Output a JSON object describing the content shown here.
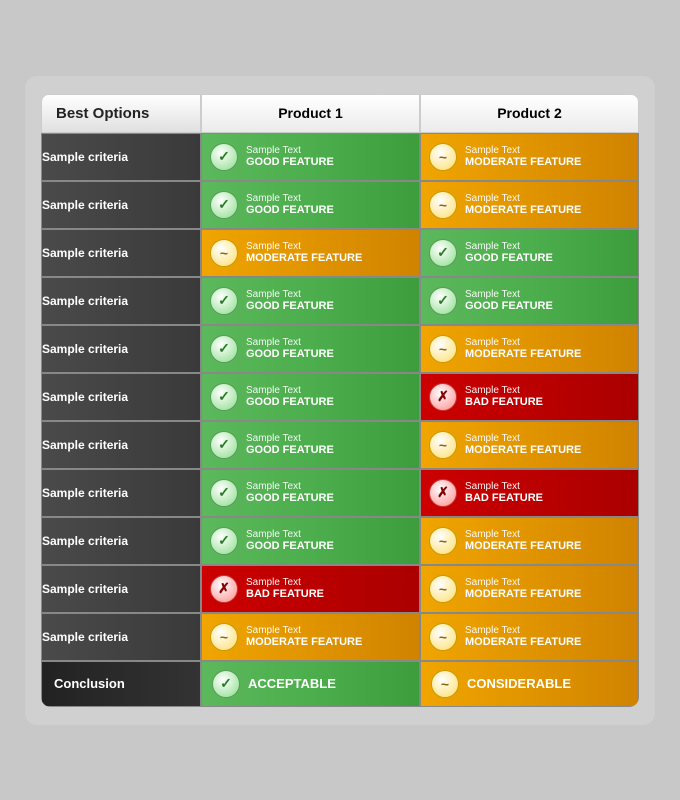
{
  "header": {
    "col1": "Best Options",
    "col2": "Product 1",
    "col3": "Product 2"
  },
  "rows": [
    {
      "criteria": "Sample criteria",
      "p1": {
        "type": "good",
        "subtitle": "Sample Text",
        "title": "GOOD FEATURE"
      },
      "p2": {
        "type": "moderate",
        "subtitle": "Sample Text",
        "title": "MODERATE FEATURE"
      }
    },
    {
      "criteria": "Sample criteria",
      "p1": {
        "type": "good",
        "subtitle": "Sample Text",
        "title": "GOOD FEATURE"
      },
      "p2": {
        "type": "moderate",
        "subtitle": "Sample Text",
        "title": "MODERATE FEATURE"
      }
    },
    {
      "criteria": "Sample criteria",
      "p1": {
        "type": "moderate",
        "subtitle": "Sample Text",
        "title": "MODERATE FEATURE"
      },
      "p2": {
        "type": "good",
        "subtitle": "Sample Text",
        "title": "GOOD FEATURE"
      }
    },
    {
      "criteria": "Sample criteria",
      "p1": {
        "type": "good",
        "subtitle": "Sample Text",
        "title": "GOOD FEATURE"
      },
      "p2": {
        "type": "good",
        "subtitle": "Sample Text",
        "title": "GOOD FEATURE"
      }
    },
    {
      "criteria": "Sample criteria",
      "p1": {
        "type": "good",
        "subtitle": "Sample Text",
        "title": "GOOD FEATURE"
      },
      "p2": {
        "type": "moderate",
        "subtitle": "Sample Text",
        "title": "MODERATE FEATURE"
      }
    },
    {
      "criteria": "Sample criteria",
      "p1": {
        "type": "good",
        "subtitle": "Sample Text",
        "title": "GOOD FEATURE"
      },
      "p2": {
        "type": "bad",
        "subtitle": "Sample Text",
        "title": "BAD FEATURE"
      }
    },
    {
      "criteria": "Sample criteria",
      "p1": {
        "type": "good",
        "subtitle": "Sample Text",
        "title": "GOOD FEATURE"
      },
      "p2": {
        "type": "moderate",
        "subtitle": "Sample Text",
        "title": "MODERATE FEATURE"
      }
    },
    {
      "criteria": "Sample criteria",
      "p1": {
        "type": "good",
        "subtitle": "Sample Text",
        "title": "GOOD FEATURE"
      },
      "p2": {
        "type": "bad",
        "subtitle": "Sample Text",
        "title": "BAD FEATURE"
      }
    },
    {
      "criteria": "Sample criteria",
      "p1": {
        "type": "good",
        "subtitle": "Sample Text",
        "title": "GOOD FEATURE"
      },
      "p2": {
        "type": "moderate",
        "subtitle": "Sample Text",
        "title": "MODERATE FEATURE"
      }
    },
    {
      "criteria": "Sample criteria",
      "p1": {
        "type": "bad",
        "subtitle": "Sample Text",
        "title": "BAD FEATURE"
      },
      "p2": {
        "type": "moderate",
        "subtitle": "Sample Text",
        "title": "MODERATE FEATURE"
      }
    },
    {
      "criteria": "Sample criteria",
      "p1": {
        "type": "moderate",
        "subtitle": "Sample Text",
        "title": "MODERATE FEATURE"
      },
      "p2": {
        "type": "moderate",
        "subtitle": "Sample Text",
        "title": "MODERATE FEATURE"
      }
    }
  ],
  "conclusion": {
    "label": "Conclusion",
    "p1": {
      "type": "good",
      "text": "ACCEPTABLE"
    },
    "p2": {
      "type": "moderate",
      "text": "CONSIDERABLE"
    }
  },
  "icons": {
    "good": "✓",
    "moderate": "~",
    "bad": "✕"
  }
}
